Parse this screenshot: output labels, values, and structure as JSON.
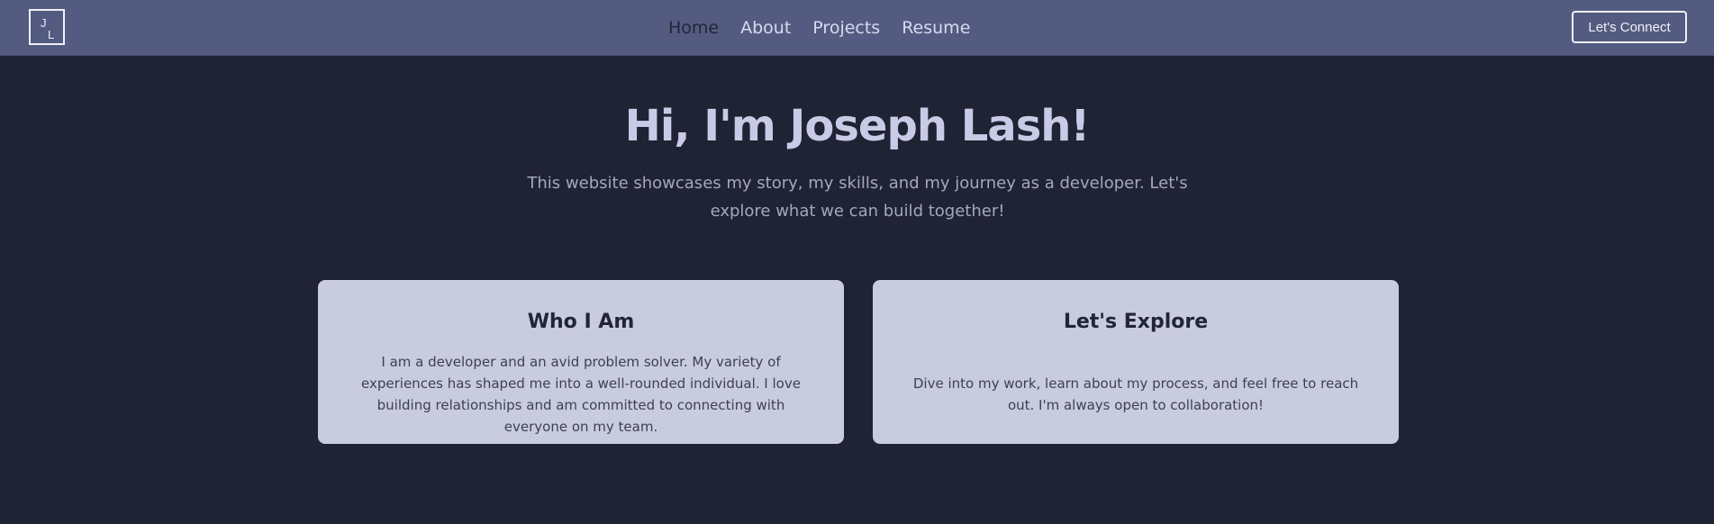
{
  "nav": {
    "logo_letters": [
      "J",
      "L"
    ],
    "links": [
      "Home",
      "About",
      "Projects",
      "Resume"
    ],
    "active_link": "Home",
    "cta_label": "Let's Connect"
  },
  "hero": {
    "title": "Hi, I'm Joseph Lash!",
    "subtitle": "This website showcases my story, my skills, and my journey as a developer. Let's explore what we can build together!"
  },
  "cards": [
    {
      "title": "Who I Am",
      "text": "I am a developer and an avid problem solver. My variety of experiences has shaped me into a well-rounded individual. I love building relationships and am committed to connecting with everyone on my team."
    },
    {
      "title": "Let's Explore",
      "text": "Dive into my work, learn about my process, and feel free to reach out. I'm always open to collaboration!"
    }
  ],
  "colors": {
    "navbar_bg": "#545b80",
    "page_bg": "#202334",
    "card_bg": "#c9cbdf",
    "heading": "#c9cbe6",
    "active_link": "#22253a"
  }
}
